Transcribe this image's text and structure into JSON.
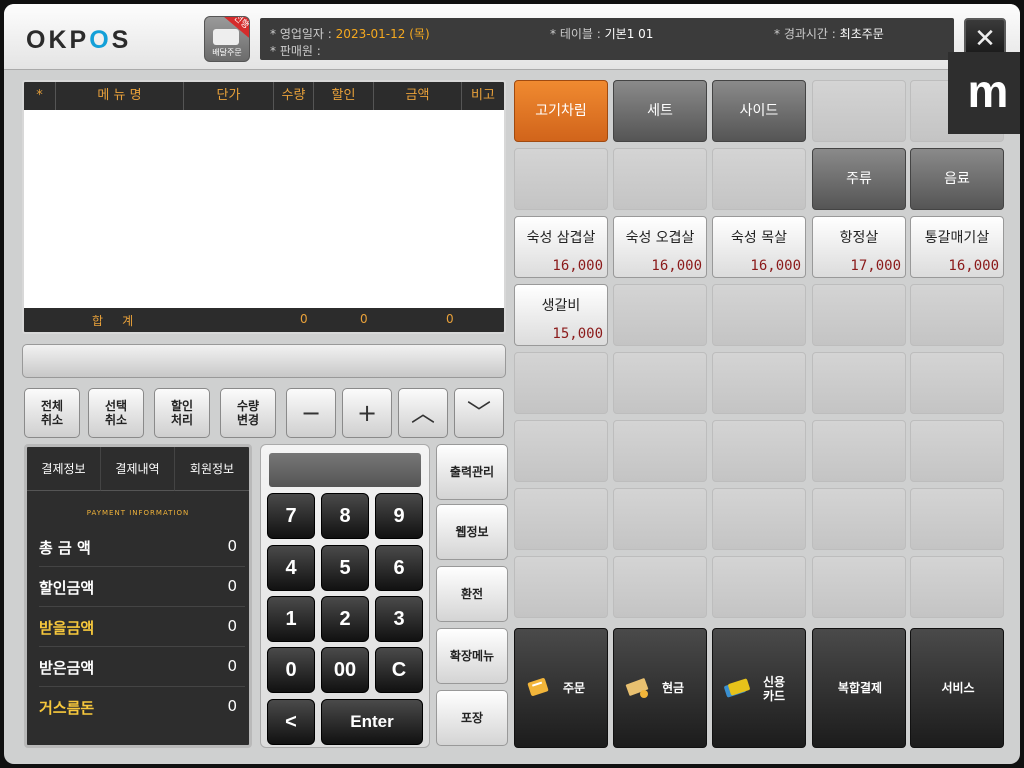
{
  "header": {
    "logo_prefix": "OKP",
    "logo_highlight": "O",
    "logo_suffix": "S",
    "delivery_badge": "선행",
    "delivery_label": "배달주문",
    "business_date_label": "* 영업일자 :",
    "business_date": "2023-01-12 (목)",
    "table_label": "* 테이블 :",
    "table_value": "기본1 01",
    "elapsed_label": "* 경과시간 :",
    "elapsed_value": "최초주문",
    "seller_label": "* 판매원 :",
    "seller_value": "",
    "close_symbol": "✕",
    "m_badge": "m"
  },
  "order_table": {
    "columns": [
      "*",
      "메 뉴 명",
      "단가",
      "수량",
      "할인",
      "금액",
      "비고"
    ],
    "rows": [],
    "sum_label": "합     계",
    "sum_qty": "0",
    "sum_discount": "0",
    "sum_amount": "0"
  },
  "function_buttons": [
    {
      "label": "전체\n취소"
    },
    {
      "label": "선택\n취소"
    },
    {
      "label": "할인\n처리"
    },
    {
      "label": "수량\n변경"
    }
  ],
  "arrow_buttons": [
    "−",
    "+",
    "︿",
    "﹀"
  ],
  "payment_panel": {
    "tabs": [
      "결제정보",
      "결제내역",
      "회원정보"
    ],
    "heading": "PAYMENT INFORMATION",
    "rows": [
      {
        "label": "총 금 액",
        "value": "0",
        "highlight": false
      },
      {
        "label": "할인금액",
        "value": "0",
        "highlight": false
      },
      {
        "label": "받을금액",
        "value": "0",
        "highlight": true
      },
      {
        "label": "받은금액",
        "value": "0",
        "highlight": false
      },
      {
        "label": "거스름돈",
        "value": "0",
        "highlight": true
      }
    ]
  },
  "keypad": {
    "keys": [
      "7",
      "8",
      "9",
      "4",
      "5",
      "6",
      "1",
      "2",
      "3",
      "0",
      "00",
      "C"
    ],
    "back": "<",
    "enter": "Enter"
  },
  "side_buttons": [
    "출력관리",
    "웹정보",
    "환전",
    "확장메뉴",
    "포장"
  ],
  "categories": [
    {
      "label": "고기차림",
      "active": true
    },
    {
      "label": "세트",
      "active": false
    },
    {
      "label": "사이드",
      "active": false
    },
    {
      "label": "주류",
      "active": false
    },
    {
      "label": "음료",
      "active": false
    }
  ],
  "menu_items": [
    {
      "name": "숙성 삼겹살",
      "price": "16,000"
    },
    {
      "name": "숙성 오겹살",
      "price": "16,000"
    },
    {
      "name": "숙성 목살",
      "price": "16,000"
    },
    {
      "name": "항정살",
      "price": "17,000"
    },
    {
      "name": "통갈매기살",
      "price": "16,000"
    },
    {
      "name": "생갈비",
      "price": "15,000"
    }
  ],
  "payment_buttons": [
    {
      "label": "주문",
      "icon": "order-icon",
      "icon_color": "#f2b53a"
    },
    {
      "label": "현금",
      "icon": "cash-icon",
      "icon_color": "#e8c070"
    },
    {
      "label": "신용\n카드",
      "icon": "card-icon",
      "icon_color": "#e6c21a"
    },
    {
      "label": "복합결제",
      "icon": "",
      "icon_color": ""
    },
    {
      "label": "서비스",
      "icon": "",
      "icon_color": ""
    }
  ]
}
